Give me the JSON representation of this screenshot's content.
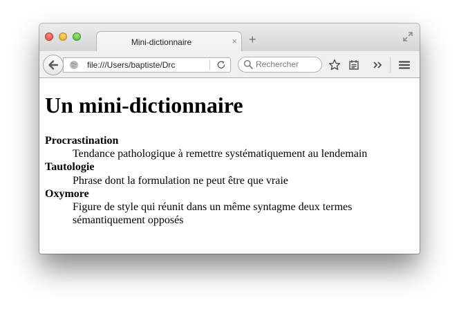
{
  "browser": {
    "tab": {
      "title": "Mini-dictionnaire",
      "close": "×"
    },
    "new_tab": "+",
    "address": {
      "url": "file:///Users/baptiste/Drc"
    },
    "search": {
      "placeholder": "Rechercher"
    },
    "icons": [
      "back-arrow-icon",
      "globe-icon",
      "reload-icon",
      "search-icon",
      "star-icon",
      "reading-list-icon",
      "overflow-chevron-icon",
      "hamburger-menu-icon",
      "fullscreen-icon"
    ]
  },
  "page": {
    "heading": "Un mini-dictionnaire",
    "entries": [
      {
        "term": "Procrastination",
        "definition": "Tendance pathologique à remettre systématiquement au lendemain"
      },
      {
        "term": "Tautologie",
        "definition": "Phrase dont la formulation ne peut être que vraie"
      },
      {
        "term": "Oxymore",
        "definition": "Figure de style qui réunit dans un même syntagme deux termes sémantiquement opposés"
      }
    ]
  }
}
